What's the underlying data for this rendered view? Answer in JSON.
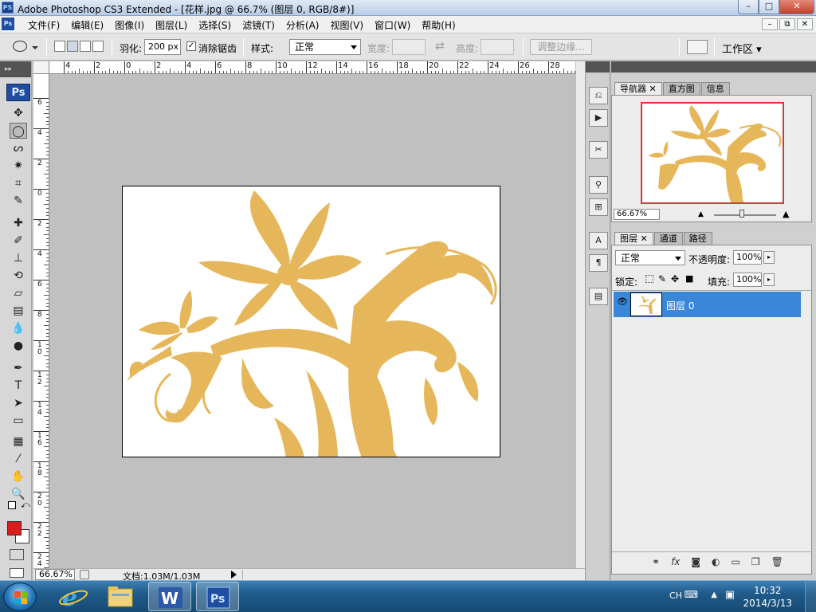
{
  "window": {
    "app_icon": "PS",
    "title": "Adobe Photoshop CS3 Extended - [花样.jpg @ 66.7% (图层 0, RGB/8#)]",
    "controls": {
      "minimize": "–",
      "maximize": "□",
      "close": "✕"
    }
  },
  "menu": {
    "logo": "Ps",
    "items": [
      "文件(F)",
      "编辑(E)",
      "图像(I)",
      "图层(L)",
      "选择(S)",
      "滤镜(T)",
      "分析(A)",
      "视图(V)",
      "窗口(W)",
      "帮助(H)"
    ],
    "mdi_controls": [
      "–",
      "⧉",
      "✕"
    ]
  },
  "options": {
    "feather_label": "羽化:",
    "feather_value": "200 px",
    "antialias_label": "消除锯齿",
    "antialias_checked": "✓",
    "style_label": "样式:",
    "style_value": "正常",
    "width_label": "宽度:",
    "swap_icon": "⇄",
    "height_label": "高度:",
    "refine_edge": "调整边缘...",
    "workspace": "工作区 ▾"
  },
  "toolbox": {
    "badge": "Ps",
    "tools": [
      {
        "name": "move-tool-icon",
        "glyph": "✥"
      },
      {
        "name": "elliptical-marquee-tool-icon",
        "glyph": "◯"
      },
      {
        "name": "lasso-tool-icon",
        "glyph": "ᔕ"
      },
      {
        "name": "magic-wand-tool-icon",
        "glyph": "✷"
      },
      {
        "name": "crop-tool-icon",
        "glyph": "⌗"
      },
      {
        "name": "slice-tool-icon",
        "glyph": "✎"
      },
      {
        "name": "healing-brush-tool-icon",
        "glyph": "✚"
      },
      {
        "name": "brush-tool-icon",
        "glyph": "✐"
      },
      {
        "name": "clone-stamp-tool-icon",
        "glyph": "⊥"
      },
      {
        "name": "history-brush-tool-icon",
        "glyph": "⟲"
      },
      {
        "name": "eraser-tool-icon",
        "glyph": "▱"
      },
      {
        "name": "gradient-tool-icon",
        "glyph": "▤"
      },
      {
        "name": "blur-tool-icon",
        "glyph": "💧"
      },
      {
        "name": "dodge-tool-icon",
        "glyph": "●"
      },
      {
        "name": "pen-tool-icon",
        "glyph": "✒"
      },
      {
        "name": "type-tool-icon",
        "glyph": "T"
      },
      {
        "name": "path-selection-tool-icon",
        "glyph": "➤"
      },
      {
        "name": "rectangle-tool-icon",
        "glyph": "▭"
      },
      {
        "name": "notes-tool-icon",
        "glyph": "▦"
      },
      {
        "name": "eyedropper-tool-icon",
        "glyph": "⁄"
      },
      {
        "name": "hand-tool-icon",
        "glyph": "✋"
      },
      {
        "name": "zoom-tool-icon",
        "glyph": "🔍"
      }
    ],
    "foreground_color": "#d91c1c",
    "background_color": "#ffffff"
  },
  "rulers": {
    "top_labels": [
      "4",
      "2",
      "0",
      "2",
      "4",
      "6",
      "8",
      "10",
      "12",
      "14",
      "16",
      "18",
      "20",
      "22",
      "24",
      "26",
      "28"
    ],
    "left_labels": [
      "6",
      "4",
      "2",
      "0",
      "2",
      "4",
      "6",
      "8",
      "10",
      "12",
      "14",
      "16",
      "18",
      "20",
      "22",
      "24"
    ]
  },
  "status": {
    "zoom": "66.67%",
    "doc_info": "文档:1.03M/1.03M"
  },
  "navigator": {
    "tabs": [
      "导航器",
      "直方图",
      "信息"
    ],
    "zoom": "66.67%"
  },
  "layers_panel": {
    "tabs": [
      "图层",
      "通道",
      "路径"
    ],
    "blend_mode": "正常",
    "opacity_label": "不透明度:",
    "opacity_value": "100%",
    "lock_label": "锁定:",
    "fill_label": "填充:",
    "fill_value": "100%",
    "layers": [
      {
        "name": "图层 0",
        "visible": true,
        "selected": true
      }
    ],
    "footer_icons": [
      "link-icon",
      "fx-icon",
      "mask-icon",
      "adjustment-icon",
      "group-icon",
      "new-layer-icon",
      "delete-icon"
    ]
  },
  "taskbar": {
    "lang": "CH",
    "time": "10:32",
    "date": "2014/3/13"
  },
  "colors": {
    "flower": "#e6b75a",
    "selection": "#3a86d8",
    "nav_frame": "#d9353a"
  }
}
